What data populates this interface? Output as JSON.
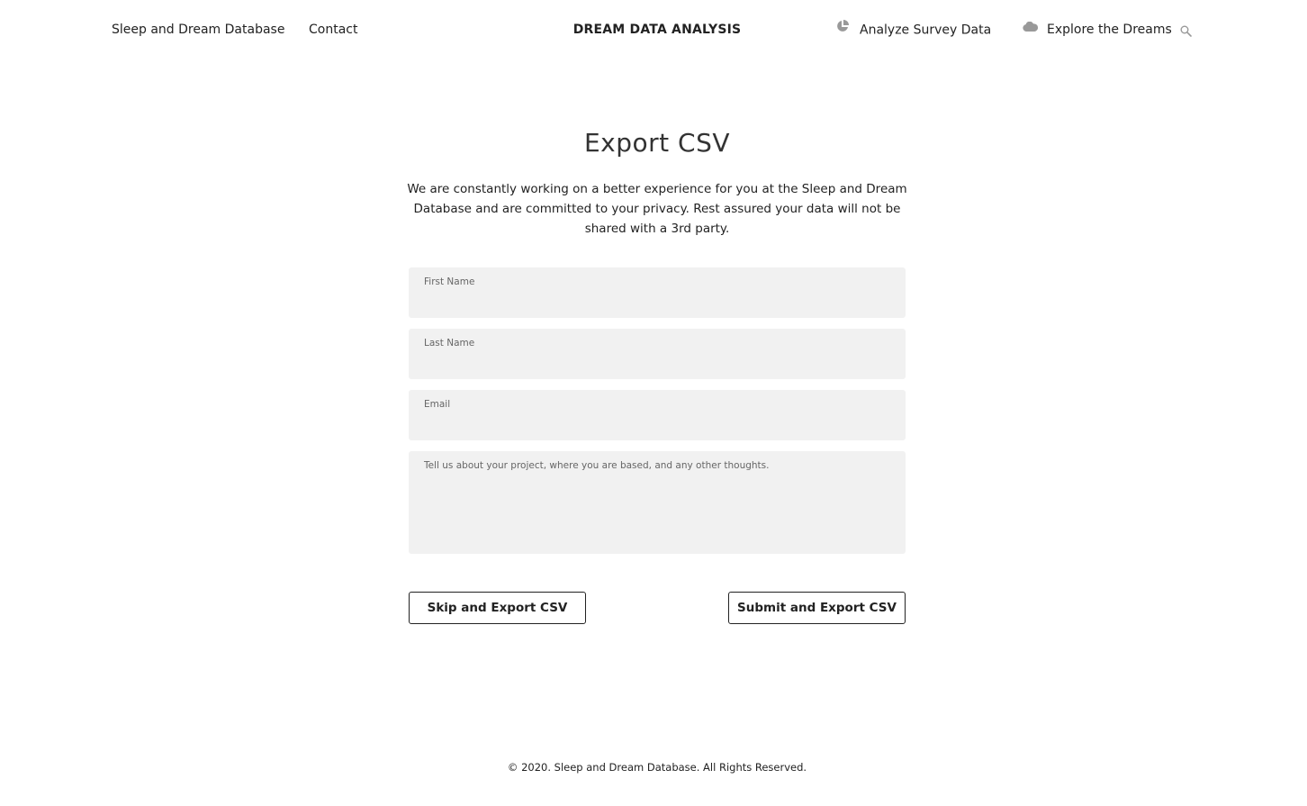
{
  "header": {
    "brand": "DREAM DATA ANALYSIS",
    "nav_left": [
      {
        "label": "Sleep and Dream Database"
      },
      {
        "label": "Contact"
      }
    ],
    "nav_right": [
      {
        "label": "Analyze Survey Data",
        "icon": "pie-chart-icon"
      },
      {
        "label": "Explore the Dreams",
        "icon": "cloud-icon"
      }
    ],
    "search_icon": "search-icon"
  },
  "main": {
    "title": "Export CSV",
    "intro": "We are constantly working on a better experience for you at the Sleep and Dream Database and are committed to your privacy. Rest assured your data will not be shared with a 3rd party.",
    "form": {
      "first_name": {
        "label": "First Name",
        "value": ""
      },
      "last_name": {
        "label": "Last Name",
        "value": ""
      },
      "email": {
        "label": "Email",
        "value": ""
      },
      "message": {
        "placeholder": "Tell us about your project, where you are based, and any other thoughts.",
        "value": ""
      }
    },
    "buttons": {
      "skip": "Skip and Export CSV",
      "submit": "Submit and Export CSV"
    }
  },
  "footer": {
    "copyright": "© 2020. Sleep and Dream Database. All Rights Reserved."
  },
  "colors": {
    "text": "#222222",
    "field_bg": "#f1f1f1",
    "icon_gray": "#999999"
  }
}
